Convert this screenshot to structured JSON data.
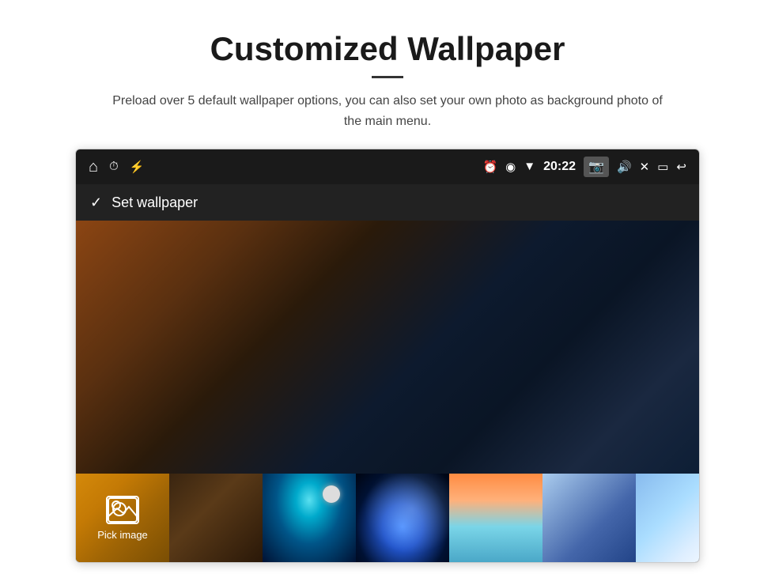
{
  "page": {
    "title": "Customized Wallpaper",
    "subtitle": "Preload over 5 default wallpaper options, you can also set your own photo as background photo of the main menu."
  },
  "statusbar": {
    "time": "20:22",
    "icons": {
      "home": "⌂",
      "alarm": "⏰",
      "location": "◉",
      "wifi": "▼",
      "camera": "📷",
      "volume": "🔊",
      "close": "✕",
      "window": "▭",
      "back": "↩",
      "usb": "⚡",
      "clock": "⏱"
    }
  },
  "appbar": {
    "check_icon": "✓",
    "label": "Set wallpaper"
  },
  "thumbnail_strip": {
    "pick_label": "Pick image"
  }
}
